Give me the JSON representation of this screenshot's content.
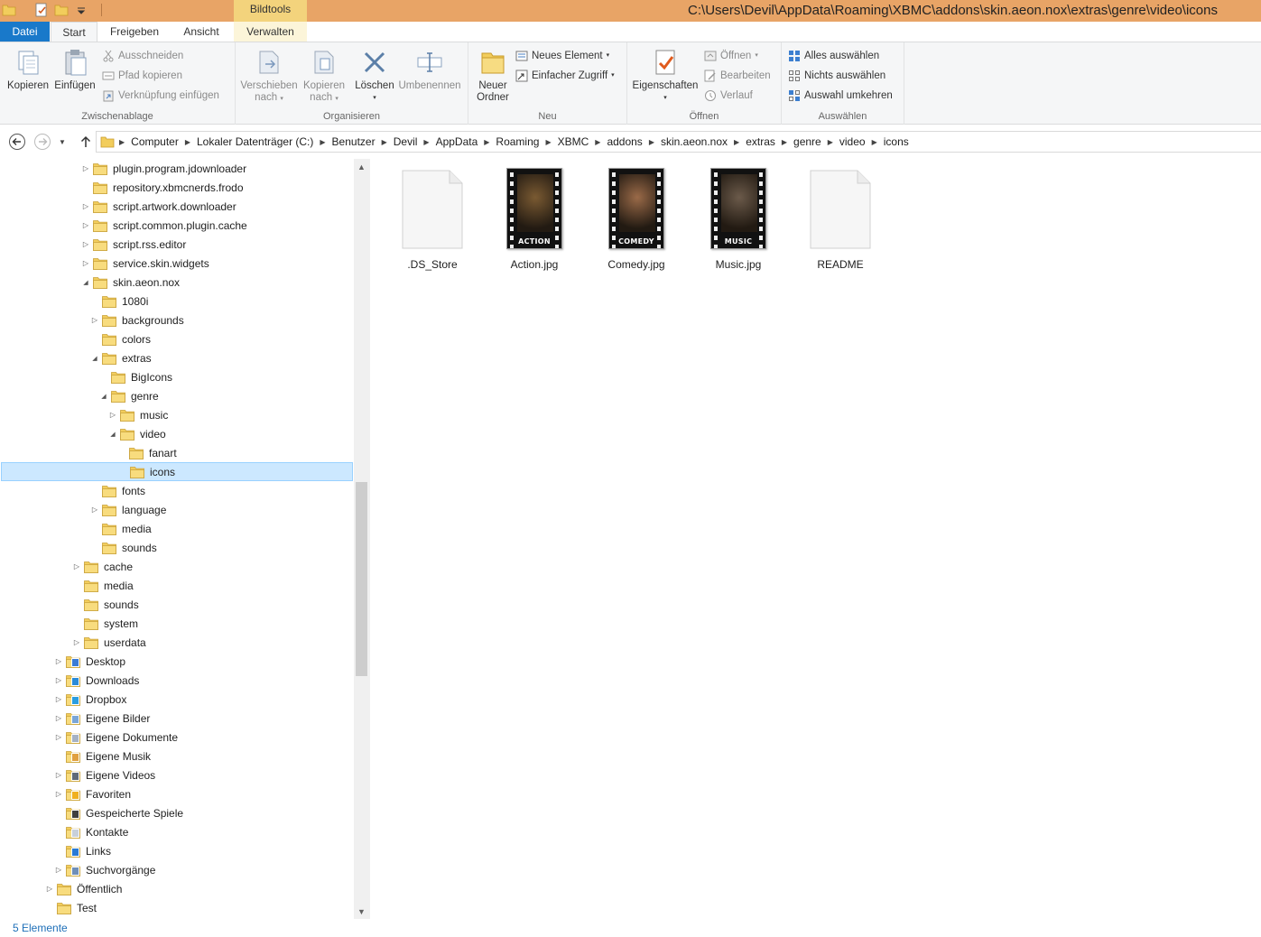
{
  "window": {
    "title_path": "C:\\Users\\Devil\\AppData\\Roaming\\XBMC\\addons\\skin.aeon.nox\\extras\\genre\\video\\icons",
    "context_tab": "Bildtools"
  },
  "ribbon_tabs": {
    "file": "Datei",
    "start": "Start",
    "share": "Freigeben",
    "view": "Ansicht",
    "manage": "Verwalten"
  },
  "ribbon": {
    "clipboard": {
      "label": "Zwischenablage",
      "copy": "Kopieren",
      "paste": "Einfügen",
      "cut": "Ausschneiden",
      "copy_path": "Pfad kopieren",
      "paste_shortcut": "Verknüpfung einfügen"
    },
    "organize": {
      "label": "Organisieren",
      "move_to_1": "Verschieben",
      "move_to_2": "nach",
      "copy_to_1": "Kopieren",
      "copy_to_2": "nach",
      "delete": "Löschen",
      "rename": "Umbenennen"
    },
    "new": {
      "label": "Neu",
      "new_folder_1": "Neuer",
      "new_folder_2": "Ordner",
      "new_item": "Neues Element",
      "easy_access": "Einfacher Zugriff"
    },
    "open": {
      "label": "Öffnen",
      "properties": "Eigenschaften",
      "open": "Öffnen",
      "edit": "Bearbeiten",
      "history": "Verlauf"
    },
    "select": {
      "label": "Auswählen",
      "select_all": "Alles auswählen",
      "select_none": "Nichts auswählen",
      "invert": "Auswahl umkehren"
    }
  },
  "breadcrumbs": [
    "Computer",
    "Lokaler Datenträger (C:)",
    "Benutzer",
    "Devil",
    "AppData",
    "Roaming",
    "XBMC",
    "addons",
    "skin.aeon.nox",
    "extras",
    "genre",
    "video",
    "icons"
  ],
  "tree": [
    {
      "label": "plugin.program.jdownloader",
      "indent": 3,
      "tw": "closed",
      "icon": "folder"
    },
    {
      "label": "repository.xbmcnerds.frodo",
      "indent": 3,
      "tw": "none",
      "icon": "folder"
    },
    {
      "label": "script.artwork.downloader",
      "indent": 3,
      "tw": "closed",
      "icon": "folder"
    },
    {
      "label": "script.common.plugin.cache",
      "indent": 3,
      "tw": "closed",
      "icon": "folder"
    },
    {
      "label": "script.rss.editor",
      "indent": 3,
      "tw": "closed",
      "icon": "folder"
    },
    {
      "label": "service.skin.widgets",
      "indent": 3,
      "tw": "closed",
      "icon": "folder"
    },
    {
      "label": "skin.aeon.nox",
      "indent": 3,
      "tw": "open",
      "icon": "folder"
    },
    {
      "label": "1080i",
      "indent": 4,
      "tw": "none",
      "icon": "folder"
    },
    {
      "label": "backgrounds",
      "indent": 4,
      "tw": "closed",
      "icon": "folder"
    },
    {
      "label": "colors",
      "indent": 4,
      "tw": "none",
      "icon": "folder"
    },
    {
      "label": "extras",
      "indent": 4,
      "tw": "open",
      "icon": "folder"
    },
    {
      "label": "BigIcons",
      "indent": 5,
      "tw": "none",
      "icon": "folder"
    },
    {
      "label": "genre",
      "indent": 5,
      "tw": "open",
      "icon": "folder"
    },
    {
      "label": "music",
      "indent": 6,
      "tw": "closed",
      "icon": "folder"
    },
    {
      "label": "video",
      "indent": 6,
      "tw": "open",
      "icon": "folder"
    },
    {
      "label": "fanart",
      "indent": 7,
      "tw": "none",
      "icon": "folder"
    },
    {
      "label": "icons",
      "indent": 7,
      "tw": "none",
      "icon": "folder",
      "selected": true
    },
    {
      "label": "fonts",
      "indent": 4,
      "tw": "none",
      "icon": "folder"
    },
    {
      "label": "language",
      "indent": 4,
      "tw": "closed",
      "icon": "folder"
    },
    {
      "label": "media",
      "indent": 4,
      "tw": "none",
      "icon": "folder"
    },
    {
      "label": "sounds",
      "indent": 4,
      "tw": "none",
      "icon": "folder"
    },
    {
      "label": "cache",
      "indent": 2,
      "tw": "closed",
      "icon": "folder"
    },
    {
      "label": "media",
      "indent": 2,
      "tw": "none",
      "icon": "folder"
    },
    {
      "label": "sounds",
      "indent": 2,
      "tw": "none",
      "icon": "folder"
    },
    {
      "label": "system",
      "indent": 2,
      "tw": "none",
      "icon": "folder"
    },
    {
      "label": "userdata",
      "indent": 2,
      "tw": "closed",
      "icon": "folder"
    },
    {
      "label": "Desktop",
      "indent": 0,
      "tw": "closed",
      "icon": "desktop"
    },
    {
      "label": "Downloads",
      "indent": 0,
      "tw": "closed",
      "icon": "downloads"
    },
    {
      "label": "Dropbox",
      "indent": 0,
      "tw": "closed",
      "icon": "dropbox"
    },
    {
      "label": "Eigene Bilder",
      "indent": 0,
      "tw": "closed",
      "icon": "pictures"
    },
    {
      "label": "Eigene Dokumente",
      "indent": 0,
      "tw": "closed",
      "icon": "documents"
    },
    {
      "label": "Eigene Musik",
      "indent": 0,
      "tw": "none",
      "icon": "music"
    },
    {
      "label": "Eigene Videos",
      "indent": 0,
      "tw": "closed",
      "icon": "videos"
    },
    {
      "label": "Favoriten",
      "indent": 0,
      "tw": "closed",
      "icon": "favorites"
    },
    {
      "label": "Gespeicherte Spiele",
      "indent": 0,
      "tw": "none",
      "icon": "games"
    },
    {
      "label": "Kontakte",
      "indent": 0,
      "tw": "none",
      "icon": "contacts"
    },
    {
      "label": "Links",
      "indent": 0,
      "tw": "none",
      "icon": "links"
    },
    {
      "label": "Suchvorgänge",
      "indent": 0,
      "tw": "closed",
      "icon": "searches"
    },
    {
      "label": "Öffentlich",
      "indent": -1,
      "tw": "closed",
      "icon": "folder"
    },
    {
      "label": "Test",
      "indent": -1,
      "tw": "none",
      "icon": "folder"
    }
  ],
  "files": [
    {
      "name": ".DS_Store",
      "type": "blank",
      "caption": ""
    },
    {
      "name": "Action.jpg",
      "type": "image",
      "caption": "ACTION",
      "tone": "#7a5a32"
    },
    {
      "name": "Comedy.jpg",
      "type": "image",
      "caption": "COMEDY",
      "tone": "#9a6a48"
    },
    {
      "name": "Music.jpg",
      "type": "image",
      "caption": "MUSIC",
      "tone": "#6b5a4a"
    },
    {
      "name": "README",
      "type": "blank",
      "caption": ""
    }
  ],
  "status": {
    "count": "5 Elemente"
  },
  "colors": {
    "title_bar": "#e8a466",
    "file_tab": "#1979ca",
    "selected_bg": "#cce8ff",
    "folder": "#f2cd5c"
  }
}
